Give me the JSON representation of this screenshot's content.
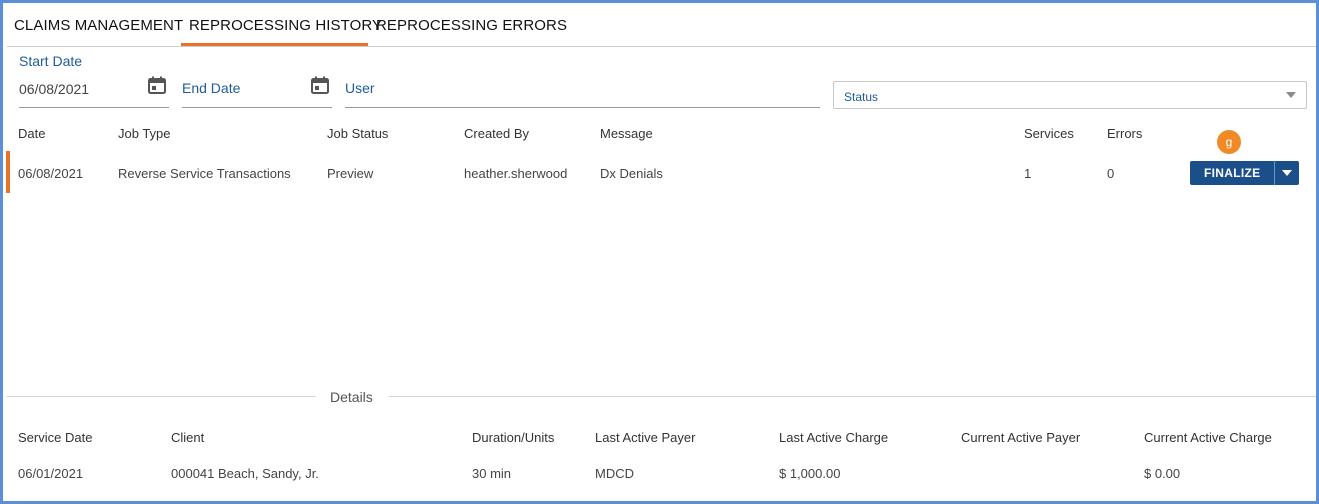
{
  "tabs": [
    {
      "label": "CLAIMS MANAGEMENT",
      "active": false
    },
    {
      "label": "REPROCESSING HISTORY",
      "active": true
    },
    {
      "label": "REPROCESSING ERRORS",
      "active": false
    }
  ],
  "filters": {
    "start_date_label": "Start Date",
    "start_date_value": "06/08/2021",
    "end_date_label": "End Date",
    "user_label": "User",
    "status_placeholder": "Status"
  },
  "jobs_table": {
    "headers": {
      "date": "Date",
      "job_type": "Job Type",
      "job_status": "Job Status",
      "created_by": "Created By",
      "message": "Message",
      "services": "Services",
      "errors": "Errors"
    },
    "rows": [
      {
        "date": "06/08/2021",
        "job_type": "Reverse Service Transactions",
        "job_status": "Preview",
        "created_by": "heather.sherwood",
        "message": "Dx Denials",
        "services": "1",
        "errors": "0",
        "action_label": "FINALIZE"
      }
    ],
    "callout_badge": "g"
  },
  "details": {
    "title": "Details",
    "headers": {
      "service_date": "Service Date",
      "client": "Client",
      "duration_units": "Duration/Units",
      "last_active_payer": "Last Active Payer",
      "last_active_charge": "Last Active Charge",
      "current_active_payer": "Current Active Payer",
      "current_active_charge": "Current Active Charge"
    },
    "rows": [
      {
        "service_date": "06/01/2021",
        "client": "000041 Beach, Sandy, Jr.",
        "duration_units": "30 min",
        "last_active_payer": "MDCD",
        "last_active_charge": "$ 1,000.00",
        "current_active_payer": "",
        "current_active_charge": "$ 0.00"
      }
    ]
  },
  "colors": {
    "accent": "#e8722b",
    "primary": "#1a4f8a",
    "label_blue": "#1f5c99",
    "badge": "#f08a24",
    "frame_border": "#5b8fd6"
  }
}
